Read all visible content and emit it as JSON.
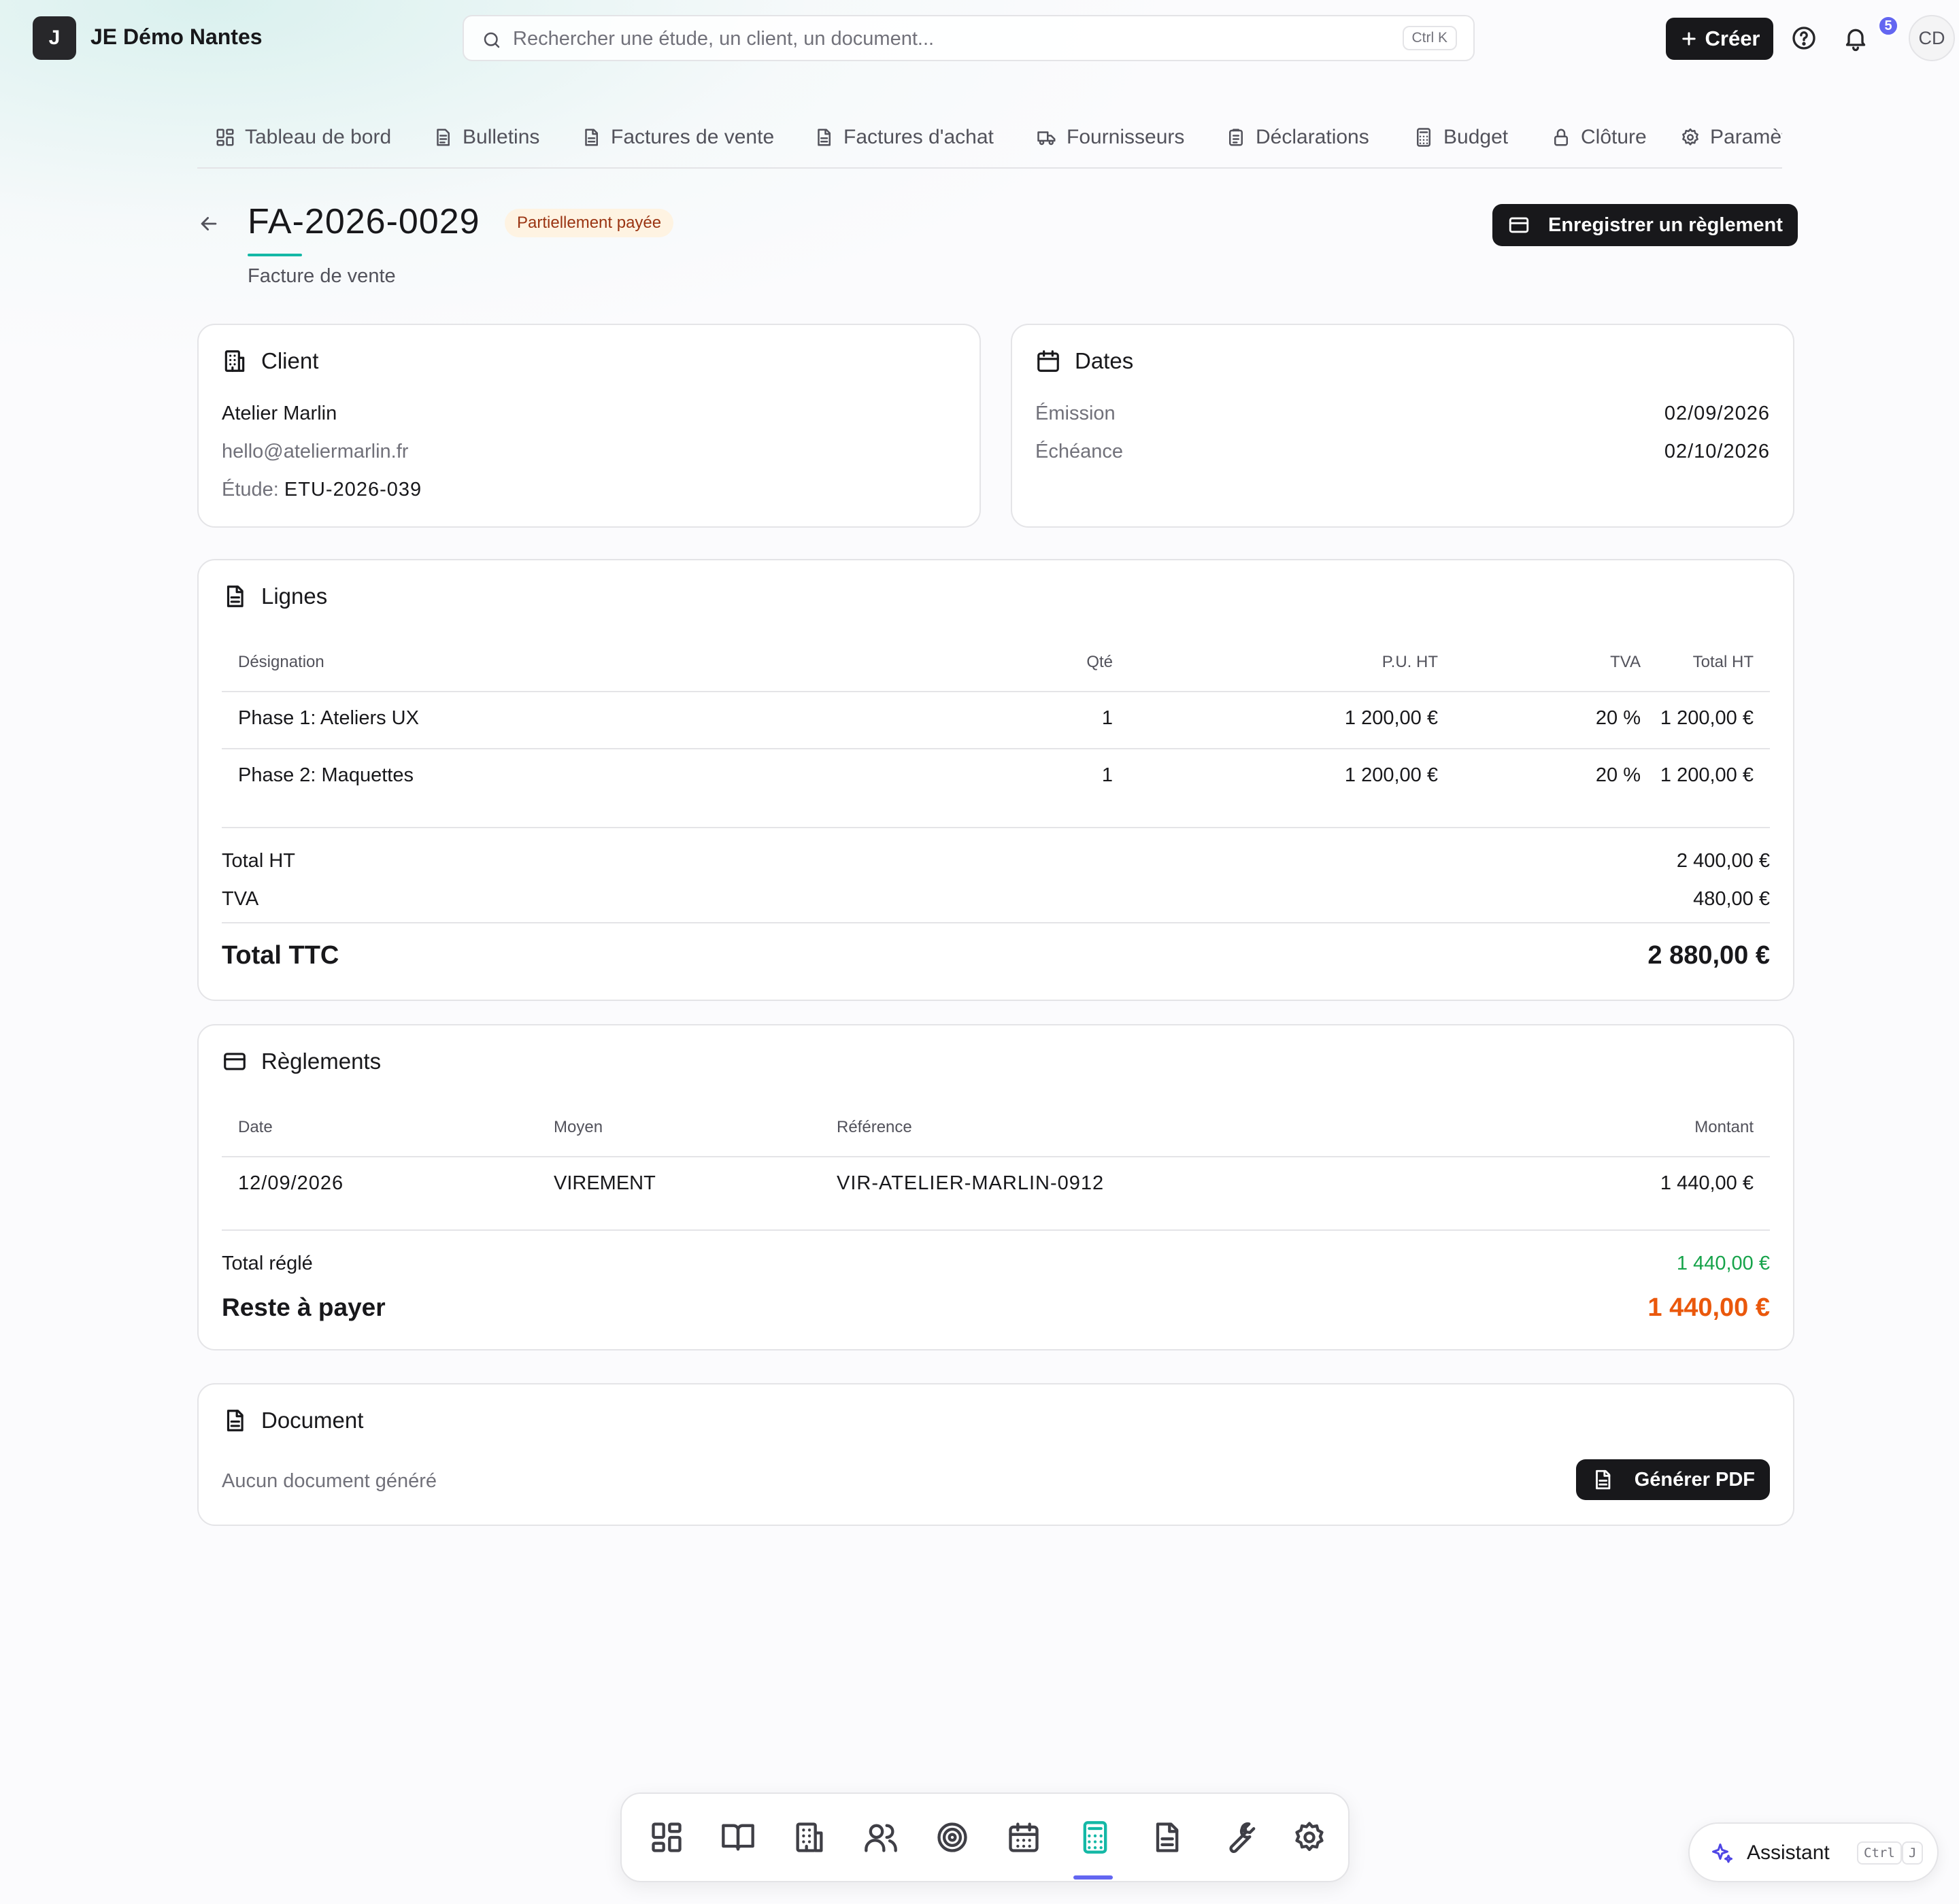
{
  "app": {
    "logo_letter": "J",
    "name": "JE Démo Nantes"
  },
  "search": {
    "placeholder": "Rechercher une étude, un client, un document...",
    "shortcut": "Ctrl K"
  },
  "topbar": {
    "create_label": "Créer",
    "notifications_count": "5",
    "avatar_initials": "CD"
  },
  "tabs": [
    {
      "label": "Tableau de bord",
      "icon": "dashboard-icon"
    },
    {
      "label": "Bulletins",
      "icon": "document-icon"
    },
    {
      "label": "Factures de vente",
      "icon": "document-icon"
    },
    {
      "label": "Factures d'achat",
      "icon": "document-icon"
    },
    {
      "label": "Fournisseurs",
      "icon": "truck-icon"
    },
    {
      "label": "Déclarations",
      "icon": "clipboard-icon"
    },
    {
      "label": "Budget",
      "icon": "calculator-icon"
    },
    {
      "label": "Clôture",
      "icon": "lock-icon"
    },
    {
      "label": "Paramètres",
      "icon": "gear-icon"
    }
  ],
  "invoice": {
    "number": "FA-2026-0029",
    "status": "Partiellement payée",
    "type": "Facture de vente",
    "record_payment_label": "Enregistrer un règlement"
  },
  "client": {
    "title": "Client",
    "name": "Atelier Marlin",
    "email": "hello@ateliermarlin.fr",
    "study_label": "Étude:",
    "study_ref": "ETU-2026-039"
  },
  "dates": {
    "title": "Dates",
    "issue_label": "Émission",
    "issue_value": "02/09/2026",
    "due_label": "Échéance",
    "due_value": "02/10/2026"
  },
  "lines": {
    "title": "Lignes",
    "headers": {
      "designation": "Désignation",
      "qty": "Qté",
      "unit_price": "P.U. HT",
      "vat": "TVA",
      "total": "Total HT"
    },
    "rows": [
      {
        "designation": "Phase 1: Ateliers UX",
        "qty": "1",
        "unit_price": "1 200,00 €",
        "vat": "20 %",
        "total": "1 200,00 €"
      },
      {
        "designation": "Phase 2: Maquettes",
        "qty": "1",
        "unit_price": "1 200,00 €",
        "vat": "20 %",
        "total": "1 200,00 €"
      }
    ],
    "total_ht_label": "Total HT",
    "total_ht_value": "2 400,00 €",
    "vat_label": "TVA",
    "vat_value": "480,00 €",
    "total_ttc_label": "Total TTC",
    "total_ttc_value": "2 880,00 €"
  },
  "payments": {
    "title": "Règlements",
    "headers": {
      "date": "Date",
      "method": "Moyen",
      "reference": "Référence",
      "amount": "Montant"
    },
    "rows": [
      {
        "date": "12/09/2026",
        "method": "VIREMENT",
        "reference": "VIR-ATELIER-MARLIN-0912",
        "amount": "1 440,00 €"
      }
    ],
    "total_paid_label": "Total réglé",
    "total_paid_value": "1 440,00 €",
    "remaining_label": "Reste à payer",
    "remaining_value": "1 440,00 €"
  },
  "document": {
    "title": "Document",
    "empty_text": "Aucun document généré",
    "generate_label": "Générer PDF"
  },
  "dock": {
    "items": [
      "dashboard-icon",
      "book-icon",
      "building-icon",
      "users-icon",
      "target-icon",
      "calendar-icon",
      "calculator-icon",
      "document-icon",
      "wrench-icon",
      "gear-icon"
    ],
    "active": "calculator-icon"
  },
  "assistant": {
    "label": "Assistant",
    "shortcut_1": "Ctrl",
    "shortcut_2": "J"
  },
  "colors": {
    "accent_teal": "#14b8a6",
    "accent_indigo": "#6366f1",
    "paid_green": "#16a34a",
    "remaining_orange": "#ea580c",
    "status_bg": "#fef3e2"
  }
}
